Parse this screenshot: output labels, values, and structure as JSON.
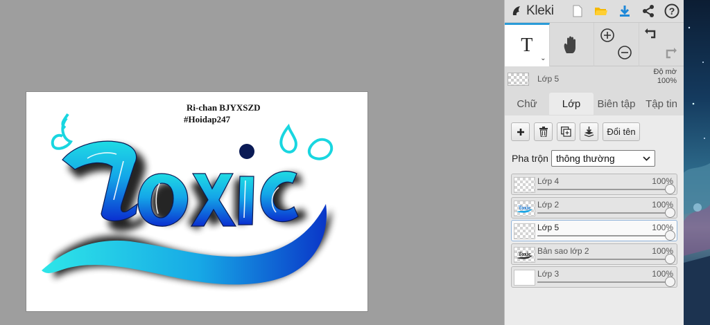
{
  "app": {
    "name": "Kleki"
  },
  "artboard": {
    "credit_line1": "Ri-chan BJYXSZD",
    "credit_line2": "#Hoidap247",
    "artwork_word": "Toxic"
  },
  "toolbar": {
    "icons": [
      "new-file-icon",
      "open-folder-icon",
      "download-icon",
      "share-icon",
      "help-icon"
    ],
    "tool_text_glyph": "T"
  },
  "layer_info": {
    "name": "Lớp 5",
    "opacity_label": "Độ mờ",
    "opacity_value": "100%"
  },
  "tabs": [
    {
      "label": "Chữ",
      "active": false
    },
    {
      "label": "Lớp",
      "active": true
    },
    {
      "label": "Biên tập",
      "active": false
    },
    {
      "label": "Tập tin",
      "active": false
    }
  ],
  "layer_panel": {
    "rename_label": "Đổi tên",
    "blend_label": "Pha trộn",
    "blend_value": "thông thường",
    "layers": [
      {
        "name": "Lớp 4",
        "opacity": "100%",
        "active": false,
        "thumb": "empty"
      },
      {
        "name": "Lớp 2",
        "opacity": "100%",
        "active": false,
        "thumb": "toxic"
      },
      {
        "name": "Lớp 5",
        "opacity": "100%",
        "active": true,
        "thumb": "empty"
      },
      {
        "name": "Bản sao lớp 2",
        "opacity": "100%",
        "active": false,
        "thumb": "toxic-dark"
      },
      {
        "name": "Lớp 3",
        "opacity": "100%",
        "active": false,
        "thumb": "white"
      }
    ]
  },
  "colors": {
    "accent": "#2a9bd8",
    "art_cyan": "#19d6e0",
    "art_blue": "#0a3fd6"
  }
}
